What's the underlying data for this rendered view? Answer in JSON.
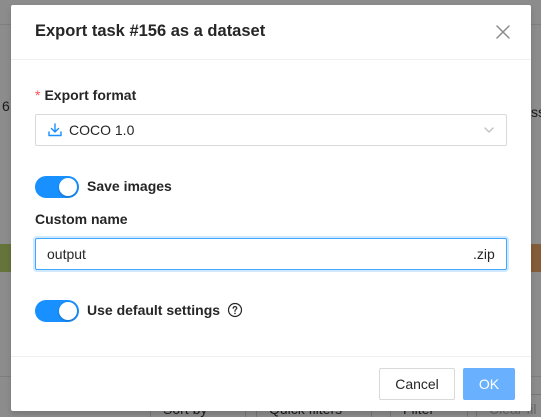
{
  "background": {
    "left_fragment": "6",
    "right_fragment": "ss",
    "bottom_buttons": {
      "sort_label": "Sort by",
      "quick_filters_label": "Quick filters",
      "filter_label": "Filter",
      "clear_label": "Clear fil"
    }
  },
  "modal": {
    "title": "Export task #156 as a dataset",
    "export_format": {
      "label": "Export format",
      "required_mark": "*",
      "selected_value": "COCO 1.0",
      "icon": "download-icon"
    },
    "save_images": {
      "label": "Save images",
      "enabled": true
    },
    "custom_name": {
      "label": "Custom name",
      "value": "output",
      "suffix": ".zip"
    },
    "use_default_settings": {
      "label": "Use default settings",
      "enabled": true,
      "help_icon": "question-circle-icon"
    },
    "footer": {
      "cancel_label": "Cancel",
      "ok_label": "OK"
    }
  },
  "colors": {
    "primary": "#1890ff",
    "ok_button": "#69b1ff",
    "required": "#ff4d4f"
  }
}
